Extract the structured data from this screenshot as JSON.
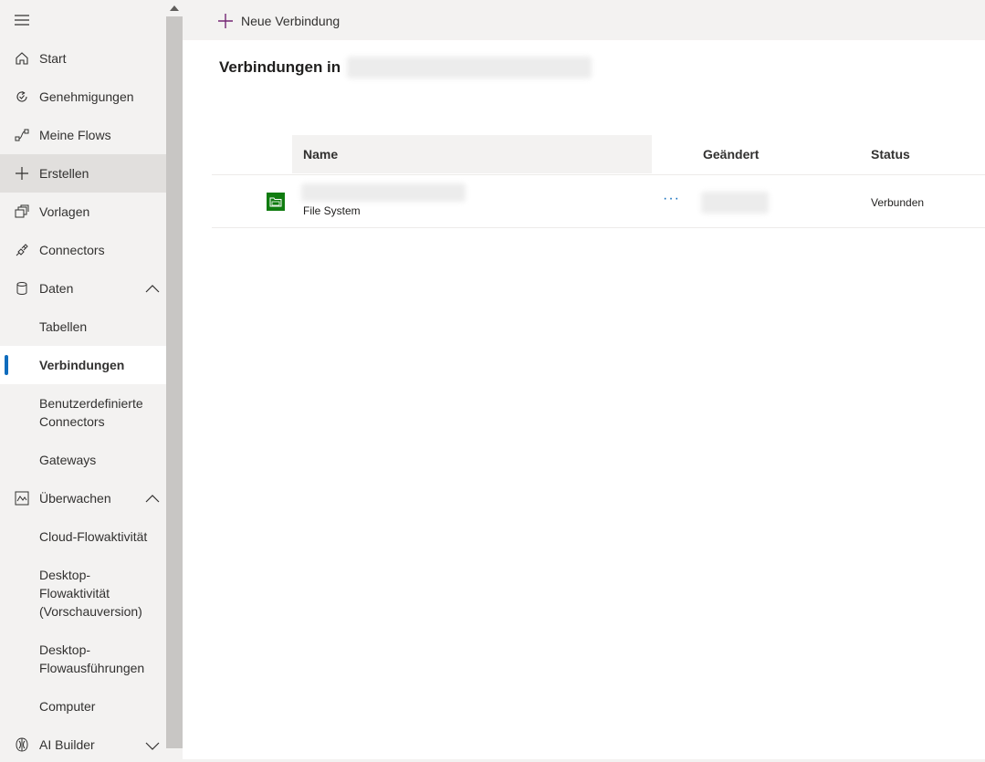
{
  "sidebar": {
    "items": [
      {
        "label": "Start"
      },
      {
        "label": "Genehmigungen"
      },
      {
        "label": "Meine Flows"
      },
      {
        "label": "Erstellen"
      },
      {
        "label": "Vorlagen"
      },
      {
        "label": "Connectors"
      },
      {
        "label": "Daten"
      },
      {
        "label": "Tabellen"
      },
      {
        "label": "Verbindungen"
      },
      {
        "label": "Benutzerdefinierte Connectors"
      },
      {
        "label": "Gateways"
      },
      {
        "label": "Überwachen"
      },
      {
        "label": "Cloud-Flowaktivität"
      },
      {
        "label": "Desktop-Flowaktivität (Vorschauversion)"
      },
      {
        "label": "Desktop-Flowausführungen"
      },
      {
        "label": "Computer"
      },
      {
        "label": "AI Builder"
      }
    ]
  },
  "toolbar": {
    "new_connection_label": "Neue Verbindung"
  },
  "page": {
    "title": "Verbindungen in"
  },
  "table": {
    "columns": {
      "name": "Name",
      "changed": "Geändert",
      "status": "Status"
    },
    "rows": [
      {
        "type": "File System",
        "more": "···",
        "status": "Verbunden"
      }
    ]
  },
  "colors": {
    "accent": "#0f6cbd",
    "connector_green": "#107c10",
    "plus_purple": "#742774"
  }
}
